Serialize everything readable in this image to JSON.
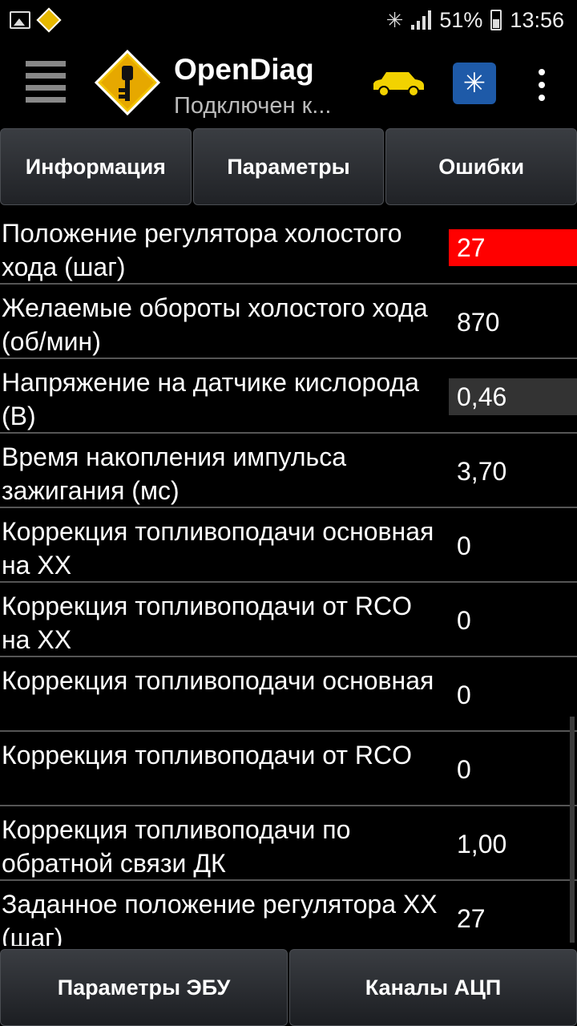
{
  "status_bar": {
    "battery": "51%",
    "time": "13:56",
    "icons": [
      "image-icon",
      "opendiag-notification-icon",
      "bluetooth-icon",
      "signal-icon",
      "battery-icon"
    ]
  },
  "app_bar": {
    "title": "OpenDiag",
    "subtitle": "Подключен к...",
    "icons": [
      "menu-icon",
      "opendiag-key-logo",
      "car-icon",
      "bluetooth-ecu-icon",
      "overflow-menu-icon"
    ]
  },
  "tabs": [
    {
      "label": "Информация"
    },
    {
      "label": "Параметры"
    },
    {
      "label": "Ошибки"
    }
  ],
  "parameters": [
    {
      "name": "Положение регулятора холостого хода (шаг)",
      "value": "27"
    },
    {
      "name": "Желаемые обороты холостого хода (об/мин)",
      "value": "870"
    },
    {
      "name": "Напряжение на датчике кислорода (В)",
      "value": "0,46"
    },
    {
      "name": "Время накопления импульса зажигания (мс)",
      "value": "3,70"
    },
    {
      "name": "Коррекция топливоподачи основная на ХХ",
      "value": "0"
    },
    {
      "name": "Коррекция топливоподачи от RCO на ХХ",
      "value": "0"
    },
    {
      "name": "Коррекция топливоподачи основная",
      "value": "0"
    },
    {
      "name": "Коррекция топливоподачи от RCO",
      "value": "0"
    },
    {
      "name": "Коррекция топливоподачи по обратной связи ДК",
      "value": "1,00"
    },
    {
      "name": "Заданное положение регулятора ХХ (шаг)",
      "value": "27"
    }
  ],
  "colors": {
    "alert_value_bg": "#ff0000",
    "dim_value_bg": "#333333",
    "car_icon": "#f2d200",
    "bt_icon_bg": "#1e5aa8"
  },
  "bottom_buttons": [
    {
      "label": "Параметры ЭБУ"
    },
    {
      "label": "Каналы АЦП"
    }
  ]
}
